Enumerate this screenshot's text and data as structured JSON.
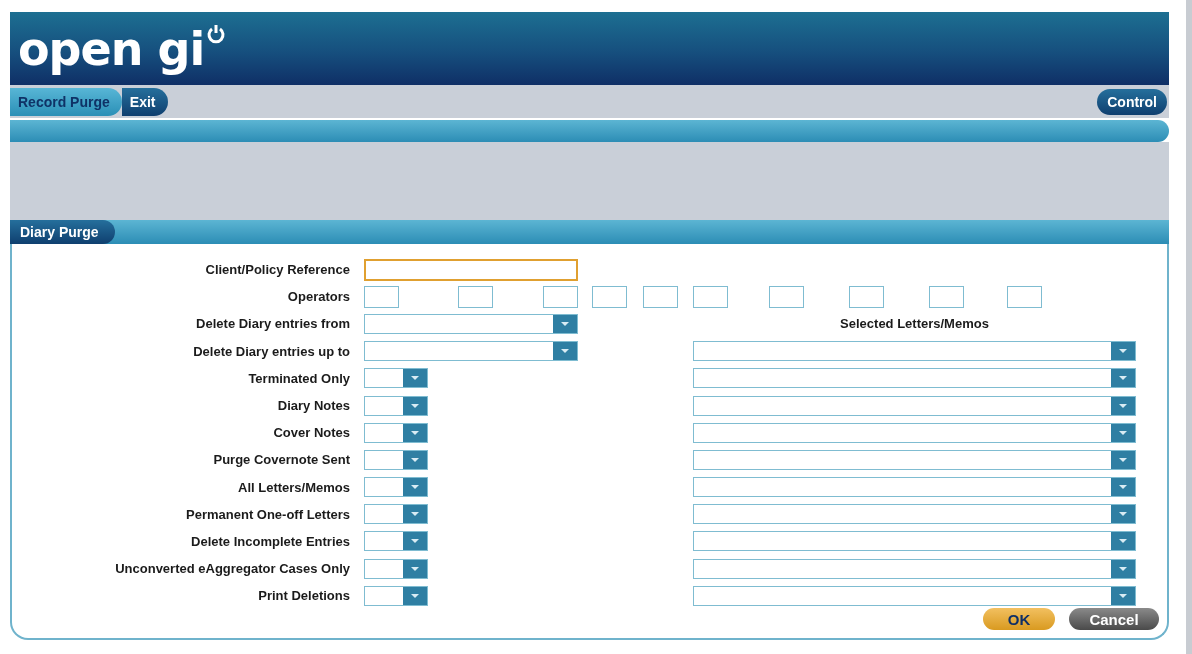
{
  "header": {
    "logo": "open gi"
  },
  "nav": {
    "tabs": [
      {
        "label": "Record Purge",
        "selected": true
      },
      {
        "label": "Exit",
        "selected": false
      }
    ],
    "control": "Control"
  },
  "section": {
    "title": "Diary Purge"
  },
  "form": {
    "rows": [
      {
        "kind": "text",
        "label": "Client/Policy Reference",
        "focused": true
      },
      {
        "kind": "operators",
        "label": "Operators"
      },
      {
        "kind": "date",
        "label": "Delete Diary entries from"
      },
      {
        "kind": "date",
        "label": "Delete Diary entries up to"
      },
      {
        "kind": "flag",
        "label": "Terminated Only"
      },
      {
        "kind": "flag",
        "label": "Diary Notes"
      },
      {
        "kind": "flag",
        "label": "Cover Notes"
      },
      {
        "kind": "flag",
        "label": "Purge Covernote Sent"
      },
      {
        "kind": "flag",
        "label": "All Letters/Memos"
      },
      {
        "kind": "flag",
        "label": "Permanent One-off Letters"
      },
      {
        "kind": "flag",
        "label": "Delete Incomplete Entries"
      },
      {
        "kind": "flag",
        "label": "Unconverted eAggregator Cases Only"
      },
      {
        "kind": "flag",
        "label": "Print Deletions"
      }
    ],
    "selected_letters": {
      "title": "Selected Letters/Memos"
    }
  },
  "buttons": [
    {
      "label": "OK",
      "kind": "primary"
    },
    {
      "label": "Cancel",
      "kind": "secondary"
    }
  ]
}
